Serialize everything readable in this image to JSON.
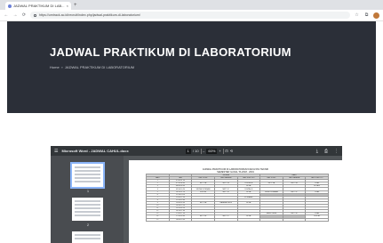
{
  "browser": {
    "tab_title": "JADWAL PRAKTIKUM DI LAB...",
    "tab_close": "×",
    "new_tab": "+",
    "url": "https://umtrack.ac.id/recruit/index.php/jadwal-praktikum-di-laboratorium/",
    "back": "←",
    "forward": "→",
    "reload": "⟳"
  },
  "hero": {
    "title": "JADWAL PRAKTIKUM DI LABORATORIUM",
    "breadcrumb": {
      "home": "Home",
      "separator": "»",
      "current": "JADWAL PRAKTIKUM DI LABORATORIUM"
    }
  },
  "pdf": {
    "menu_icon": "☰",
    "file_name": "Microsoft Word - JADWAL CAHUL.docx",
    "page_current": "1",
    "page_total": "/ 10",
    "zoom_out": "–",
    "zoom_value": "60%",
    "zoom_in": "+",
    "fit_icon": "⊡",
    "rotate_icon": "⟲",
    "download_icon": "⤓",
    "print_icon": "⎙",
    "more_icon": "⋮",
    "thumb_labels": [
      "1",
      "2"
    ],
    "doc_title_1": "JADWAL PRAKTIKUM DI LABORATORIUM FAKULTAS TEKNIK",
    "doc_title_2": "SEMESTER GASAL TA 2018 - 2019",
    "table": {
      "group_headers": [
        "",
        "",
        "SELASA",
        "RABU"
      ],
      "headers": [
        "HARI",
        "JAM",
        "LAB. KOMP",
        "LAB. BAHASA",
        "LAB. ELEKTRO",
        "LAB. KOMP",
        "LAB. BAHASA",
        "LAB. ELEKTRO"
      ],
      "rows": [
        [
          "1",
          "07.00-07.50",
          "",
          "",
          "",
          "",
          "",
          ""
        ],
        [
          "2",
          "07.50-08.40",
          "MKTI 1A",
          "MKTI 1B",
          "DIGITAL A",
          "MKTI 3A",
          "MKTI 3B",
          "PRAK"
        ],
        [
          "3",
          "08.40-09.30",
          "",
          "",
          "ELKA",
          "",
          "",
          "ELKA B"
        ],
        [
          "4",
          "09.30-10.20",
          "SISTEM OPERASI",
          "MKTI 1C",
          "DIGITAL B",
          "",
          "",
          ""
        ],
        [
          "5",
          "10.20-11.10",
          "SISTEM",
          "MKTI 1D",
          "ELKA",
          "PEMROGRAMAN",
          "MKTI 3C",
          "PRAK"
        ],
        [
          "6",
          "11.10-12.00",
          "",
          "",
          "",
          "",
          "",
          ""
        ],
        [
          "7",
          "12.00-12.50",
          "",
          "",
          "ISTIRAHAT",
          "",
          "",
          ""
        ],
        [
          "8",
          "12.50-13.40",
          "",
          "",
          "",
          "",
          "",
          ""
        ],
        [
          "9",
          "13.40-14.30",
          "MKTI 2A",
          "BAHASA ING A",
          "ELKA",
          "",
          "",
          ""
        ],
        [
          "10",
          "14.30-15.20",
          "",
          "",
          "",
          "",
          "",
          ""
        ],
        [
          "11",
          "15.20-16.10",
          "",
          "",
          "",
          "",
          "",
          ""
        ],
        [
          "12",
          "16.10-17.00",
          "",
          "",
          "",
          "",
          "",
          ""
        ],
        [
          "13",
          "17.00-17.50",
          "",
          "",
          "",
          "BASIS DATA",
          "MKTI 3D",
          "PRAK"
        ],
        [
          "14",
          "17.50-18.40",
          "MKTI 2B",
          "MKTI 2C",
          "ELKA",
          "",
          "",
          "DIGITAL"
        ],
        [
          "15",
          "18.40-19.30",
          "",
          "",
          "",
          "",
          "",
          ""
        ]
      ]
    }
  }
}
